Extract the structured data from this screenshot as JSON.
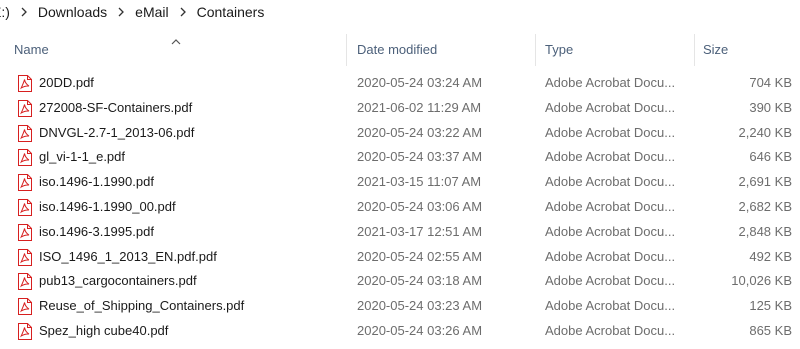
{
  "breadcrumb": {
    "items": [
      "E:)",
      "Downloads",
      "eMail",
      "Containers"
    ]
  },
  "columns": {
    "name": "Name",
    "date_modified": "Date modified",
    "type": "Type",
    "size": "Size",
    "sort_indicator_icon": "chevron-up-icon"
  },
  "file_icon": "pdf-file-icon",
  "colors": {
    "header_text": "#4c607a",
    "pdf_red": "#d71f1f",
    "secondary_text": "#6d6d6d"
  },
  "files": [
    {
      "name": "20DD.pdf",
      "date": "2020-05-24 03:24 AM",
      "type": "Adobe Acrobat Docu...",
      "size": "704 KB"
    },
    {
      "name": "272008-SF-Containers.pdf",
      "date": "2021-06-02 11:29 AM",
      "type": "Adobe Acrobat Docu...",
      "size": "390 KB"
    },
    {
      "name": "DNVGL-2.7-1_2013-06.pdf",
      "date": "2020-05-24 03:22 AM",
      "type": "Adobe Acrobat Docu...",
      "size": "2,240 KB"
    },
    {
      "name": "gl_vi-1-1_e.pdf",
      "date": "2020-05-24 03:37 AM",
      "type": "Adobe Acrobat Docu...",
      "size": "646 KB"
    },
    {
      "name": "iso.1496-1.1990.pdf",
      "date": "2021-03-15 11:07 AM",
      "type": "Adobe Acrobat Docu...",
      "size": "2,691 KB"
    },
    {
      "name": "iso.1496-1.1990_00.pdf",
      "date": "2020-05-24 03:06 AM",
      "type": "Adobe Acrobat Docu...",
      "size": "2,682 KB"
    },
    {
      "name": "iso.1496-3.1995.pdf",
      "date": "2021-03-17 12:51 AM",
      "type": "Adobe Acrobat Docu...",
      "size": "2,848 KB"
    },
    {
      "name": "ISO_1496_1_2013_EN.pdf.pdf",
      "date": "2020-05-24 02:55 AM",
      "type": "Adobe Acrobat Docu...",
      "size": "492 KB"
    },
    {
      "name": "pub13_cargocontainers.pdf",
      "date": "2020-05-24 03:18 AM",
      "type": "Adobe Acrobat Docu...",
      "size": "10,026 KB"
    },
    {
      "name": "Reuse_of_Shipping_Containers.pdf",
      "date": "2020-05-24 03:23 AM",
      "type": "Adobe Acrobat Docu...",
      "size": "125 KB"
    },
    {
      "name": "Spez_high cube40.pdf",
      "date": "2020-05-24 03:26 AM",
      "type": "Adobe Acrobat Docu...",
      "size": "865 KB"
    }
  ]
}
